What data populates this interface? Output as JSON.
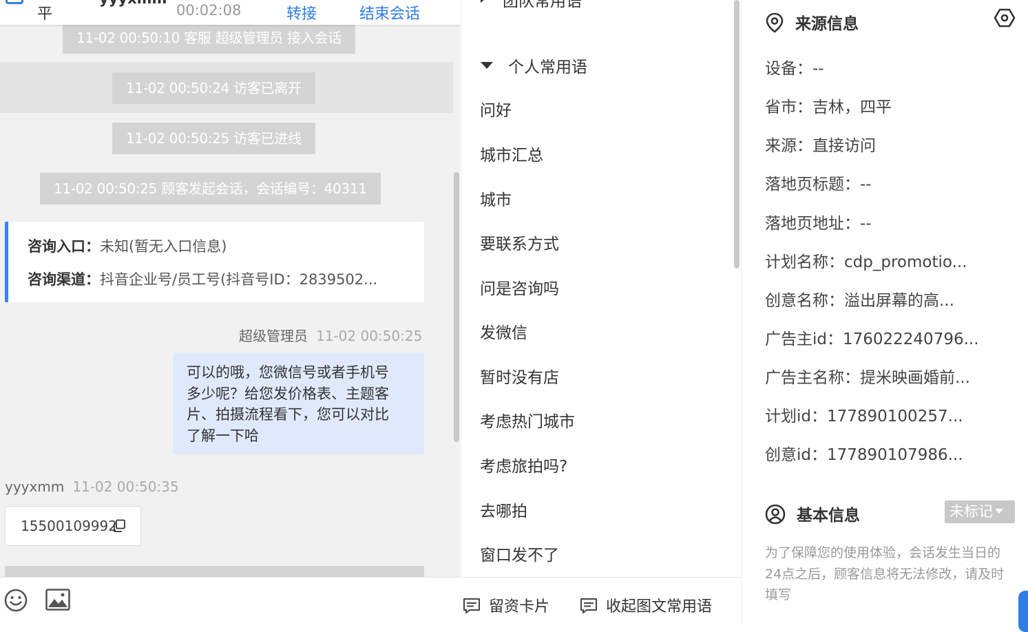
{
  "chat": {
    "header": {
      "name_fragment": "平",
      "visitor_name": "yyyxmm",
      "duration": "00:02:08",
      "transfer_label": "转接",
      "end_label": "结束会话"
    },
    "system_messages": [
      "11-02 00:50:10 客服 超级管理员 接入会话",
      "11-02 00:50:24 访客已离开",
      "11-02 00:50:25 访客已进线",
      "11-02 00:50:25 顾客发起会话，会话编号：40311"
    ],
    "entry_card": {
      "entry_key": "咨询入口：",
      "entry_value": "未知(暂无入口信息)",
      "channel_key": "咨询渠道：",
      "channel_value": "抖音企业号/员工号(抖音号ID：2839502..."
    },
    "agent_message": {
      "sender": "超级管理员",
      "time": "11-02 00:50:25",
      "lines": [
        "可以的哦，您微信号或者手机号",
        "多少呢？给您发价格表、主题客",
        "片、拍摄流程看下，您可以对比",
        "了解一下哈"
      ]
    },
    "visitor_message": {
      "sender": "yyyxmm",
      "time": "11-02 00:50:35",
      "text": "15500109992"
    }
  },
  "toolbar": {
    "lead_card_label": "留资卡片",
    "collapse_label": "收起图文常用语"
  },
  "phrases": {
    "team_group": "团队常用语",
    "personal_group": "个人常用语",
    "items": [
      "问好",
      "城市汇总",
      "城市",
      "要联系方式",
      "问是咨询吗",
      "发微信",
      "暂时没有店",
      "考虑热门城市",
      "考虑旅拍吗?",
      "去哪拍",
      "窗口发不了"
    ]
  },
  "info": {
    "source_title": "来源信息",
    "source_rows": [
      "设备：--",
      "省市：吉林，四平",
      "来源：直接访问",
      "落地页标题：--",
      "落地页地址：--",
      "计划名称：cdp_promotio...",
      "创意名称：溢出屏幕的高...",
      "广告主id：176022240796...",
      "广告主名称：提米映画婚前...",
      "计划id：177890100257...",
      "创意id：177890107986..."
    ],
    "basic_title": "基本信息",
    "tag_value": "未标记",
    "notice": "为了保障您的使用体验，会话发生当日的24点之后，顾客信息将无法修改，请及时填写"
  },
  "colors": {
    "accent": "#2f7ee6",
    "system_msg_bg": "#d4d4d4",
    "agent_bubble_bg": "#dfe9fb",
    "entry_card_border": "#3b82f6"
  }
}
